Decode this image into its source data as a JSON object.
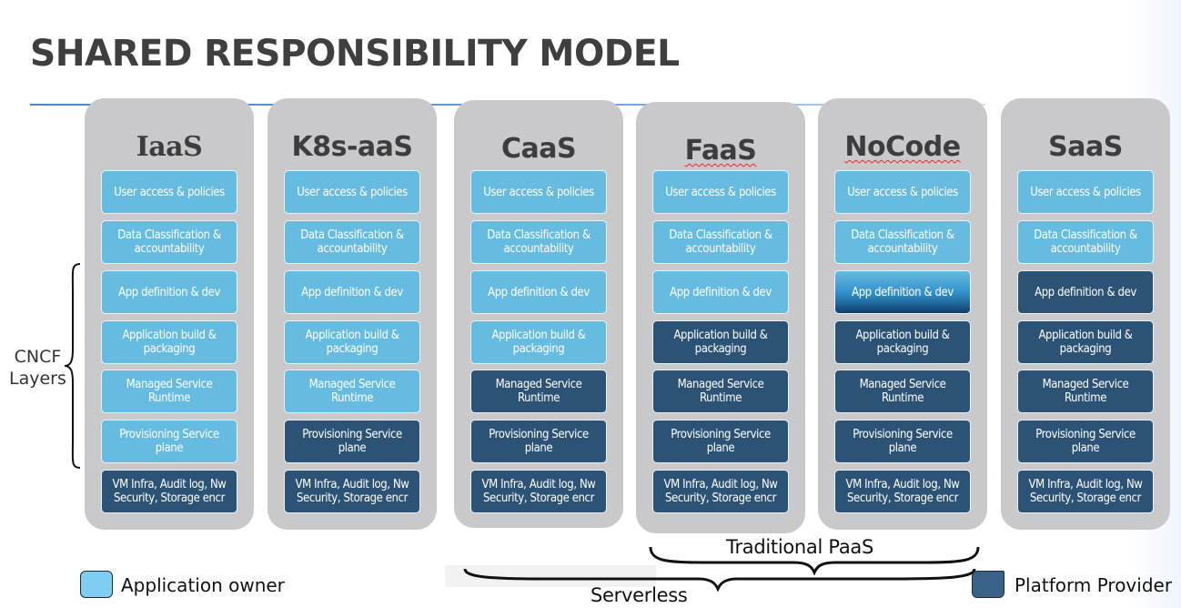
{
  "title": "SHARED RESPONSIBILITY MODEL",
  "side_label": {
    "line1": "CNCF",
    "line2": "Layers"
  },
  "colors": {
    "application_owner": "#66bbe1",
    "platform_provider": "#2c5376",
    "column_background": "#c9c9cb"
  },
  "columns": [
    {
      "name": "IaaS",
      "cells": [
        {
          "text": "User access & policies",
          "owner": "application"
        },
        {
          "text": "Data Classification & accountability",
          "owner": "application"
        },
        {
          "text": "App definition & dev",
          "owner": "application"
        },
        {
          "text": "Application build & packaging",
          "owner": "application"
        },
        {
          "text": "Managed Service Runtime",
          "owner": "application"
        },
        {
          "text": "Provisioning Service plane",
          "owner": "application"
        },
        {
          "text": "VM Infra, Audit log, Nw Security, Storage encr",
          "owner": "platform"
        }
      ]
    },
    {
      "name": "K8s-aaS",
      "cells": [
        {
          "text": "User access & policies",
          "owner": "application"
        },
        {
          "text": "Data Classification & accountability",
          "owner": "application"
        },
        {
          "text": "App definition & dev",
          "owner": "application"
        },
        {
          "text": "Application  build & packaging",
          "owner": "application"
        },
        {
          "text": "Managed Service Runtime",
          "owner": "application"
        },
        {
          "text": "Provisioning Service plane",
          "owner": "platform"
        },
        {
          "text": "VM Infra, Audit log, Nw Security, Storage encr",
          "owner": "platform"
        }
      ]
    },
    {
      "name": "CaaS",
      "cells": [
        {
          "text": "User access & policies",
          "owner": "application"
        },
        {
          "text": "Data Classification & accountability",
          "owner": "application"
        },
        {
          "text": "App definition & dev",
          "owner": "application"
        },
        {
          "text": "Application  build & packaging",
          "owner": "application"
        },
        {
          "text": "Managed Service Runtime",
          "owner": "platform"
        },
        {
          "text": "Provisioning Service plane",
          "owner": "platform"
        },
        {
          "text": "VM Infra, Audit log, Nw Security, Storage encr",
          "owner": "platform"
        }
      ]
    },
    {
      "name": "FaaS",
      "cells": [
        {
          "text": "User access & policies",
          "owner": "application"
        },
        {
          "text": "Data Classification & accountability",
          "owner": "application"
        },
        {
          "text": "App definition & dev",
          "owner": "application"
        },
        {
          "text": "Application  build & packaging",
          "owner": "platform"
        },
        {
          "text": "Managed Service Runtime",
          "owner": "platform"
        },
        {
          "text": "Provisioning Service plane",
          "owner": "platform"
        },
        {
          "text": "VM Infra, Audit log, Nw Security, Storage encr",
          "owner": "platform"
        }
      ]
    },
    {
      "name": "NoCode",
      "cells": [
        {
          "text": "User access & policies",
          "owner": "application"
        },
        {
          "text": "Data Classification & accountability",
          "owner": "application"
        },
        {
          "text": "App definition & dev",
          "owner": "shared"
        },
        {
          "text": "Application  build & packaging",
          "owner": "platform"
        },
        {
          "text": "Managed Service Runtime",
          "owner": "platform"
        },
        {
          "text": "Provisioning Service plane",
          "owner": "platform"
        },
        {
          "text": "VM Infra, Audit log, Nw Security, Storage encr",
          "owner": "platform"
        }
      ]
    },
    {
      "name": "SaaS",
      "cells": [
        {
          "text": "User access & policies",
          "owner": "application"
        },
        {
          "text": "Data Classification & accountability",
          "owner": "application"
        },
        {
          "text": "App definition & dev",
          "owner": "platform"
        },
        {
          "text": "Application  build & packaging",
          "owner": "platform"
        },
        {
          "text": "Managed Service Runtime",
          "owner": "platform"
        },
        {
          "text": "Provisioning Service plane",
          "owner": "platform"
        },
        {
          "text": "VM Infra, Audit log, Nw Security, Storage encr",
          "owner": "platform"
        }
      ]
    }
  ],
  "groups": {
    "traditional_paas": "Traditional PaaS",
    "serverless": "Serverless"
  },
  "legend": {
    "application_owner": "Application owner",
    "platform_provider": "Platform Provider"
  }
}
